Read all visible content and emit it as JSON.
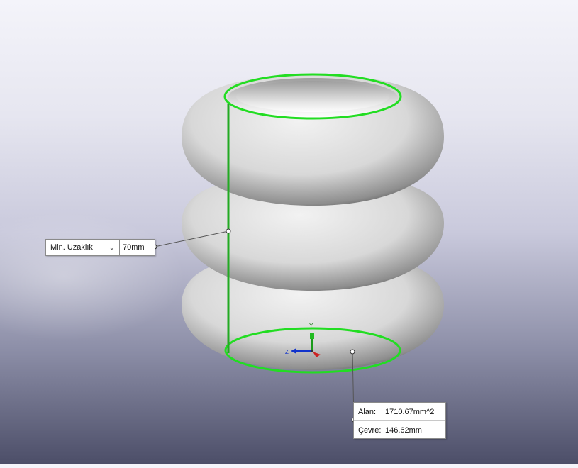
{
  "measure_tags": {
    "min_distance": {
      "mode_label": "Min. Uzaklık",
      "value": "70mm"
    },
    "section_props": {
      "area_label": "Alan:",
      "area_value": "1710.67mm^2",
      "perimeter_label": "Çevre:",
      "perimeter_value": "146.62mm"
    }
  },
  "triad": {
    "y_label": "Y",
    "z_label": "Z"
  },
  "colors": {
    "selection_green": "#22dd22",
    "model_gray": "#d9d9d9",
    "leader_line": "#555555"
  }
}
